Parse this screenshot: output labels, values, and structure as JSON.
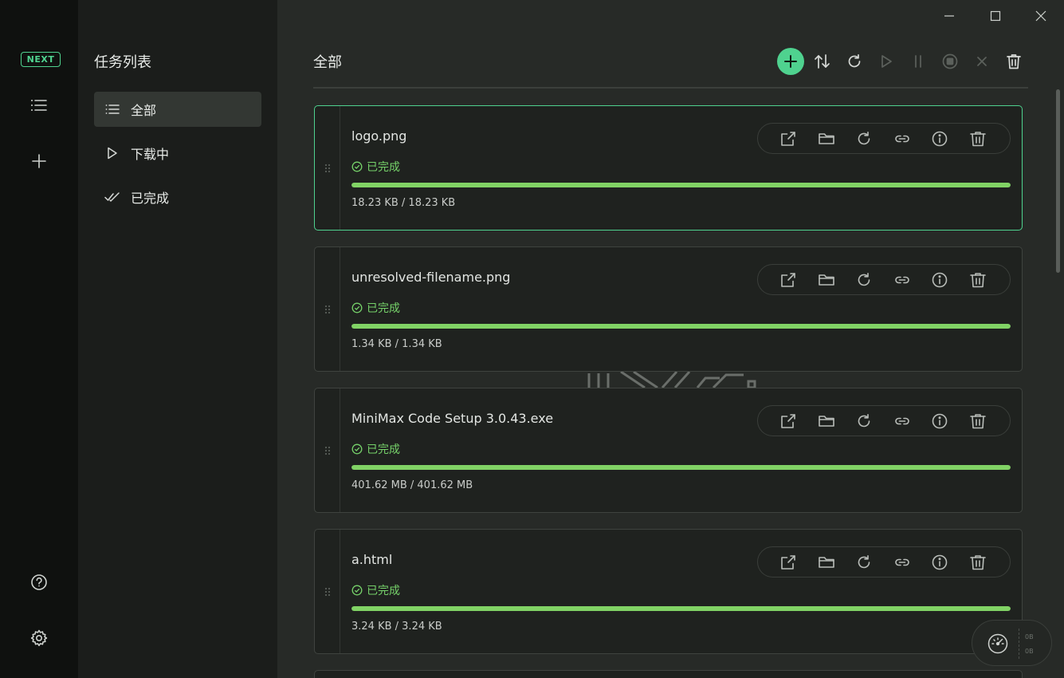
{
  "app": {
    "logo_text": "NEXT",
    "accent_color": "#4fd28f",
    "success_color": "#76d26a"
  },
  "rail": {
    "items": [
      {
        "icon": "list-icon"
      },
      {
        "icon": "plus-icon"
      },
      {
        "icon": "help-icon"
      },
      {
        "icon": "gear-icon"
      }
    ]
  },
  "sidebar": {
    "title": "任务列表",
    "items": [
      {
        "label": "全部",
        "icon": "list-icon",
        "active": true
      },
      {
        "label": "下载中",
        "icon": "play-outline-icon",
        "active": false
      },
      {
        "label": "已完成",
        "icon": "double-check-icon",
        "active": false
      }
    ]
  },
  "main": {
    "title": "全部",
    "toolbar": [
      "add-icon",
      "sort-icon",
      "refresh-icon",
      "play-icon",
      "pause-icon",
      "stop-icon",
      "cancel-icon",
      "trash-icon"
    ]
  },
  "tasks": [
    {
      "name": "logo.png",
      "status": "已完成",
      "progress": 1.0,
      "size": "18.23 KB / 18.23 KB",
      "selected": true
    },
    {
      "name": "unresolved-filename.png",
      "status": "已完成",
      "progress": 1.0,
      "size": "1.34 KB / 1.34 KB",
      "selected": false
    },
    {
      "name": "MiniMax Code Setup 3.0.43.exe",
      "status": "已完成",
      "progress": 1.0,
      "size": "401.62 MB / 401.62 MB",
      "selected": false
    },
    {
      "name": "a.html",
      "status": "已完成",
      "progress": 1.0,
      "size": "3.24 KB / 3.24 KB",
      "selected": false
    }
  ],
  "task_actions": [
    "open-external-icon",
    "folder-icon",
    "retry-icon",
    "link-icon",
    "info-icon",
    "trash-icon"
  ],
  "speed_widget": {
    "upload": "0B",
    "download": "0B"
  }
}
